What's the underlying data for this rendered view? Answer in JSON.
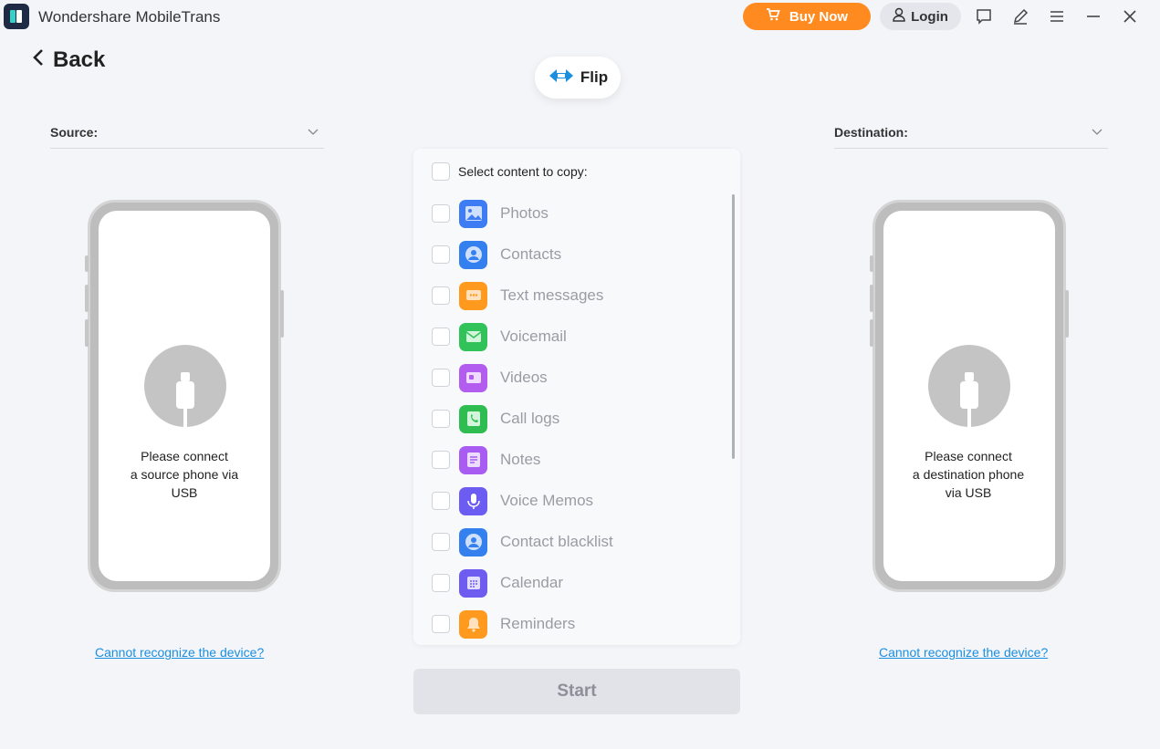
{
  "app": {
    "title": "Wondershare MobileTrans",
    "buy_now_label": "Buy Now",
    "login_label": "Login"
  },
  "nav": {
    "back_label": "Back",
    "flip_label": "Flip"
  },
  "source": {
    "label": "Source:",
    "message_line1": "Please connect",
    "message_line2": "a source phone via",
    "message_line3": "USB",
    "help_link": "Cannot recognize the device?"
  },
  "destination": {
    "label": "Destination:",
    "message_line1": "Please connect",
    "message_line2": "a destination phone",
    "message_line3": "via USB",
    "help_link": "Cannot recognize the device?"
  },
  "content_panel": {
    "header": "Select content to copy:",
    "items": [
      {
        "label": "Photos",
        "icon": "photos-icon",
        "color": "#3d7cf2"
      },
      {
        "label": "Contacts",
        "icon": "contacts-icon",
        "color": "#3580ef"
      },
      {
        "label": "Text messages",
        "icon": "messages-icon",
        "color": "#ff9a1f"
      },
      {
        "label": "Voicemail",
        "icon": "voicemail-icon",
        "color": "#31c25a"
      },
      {
        "label": "Videos",
        "icon": "videos-icon",
        "color": "#b35cf0"
      },
      {
        "label": "Call logs",
        "icon": "call-logs-icon",
        "color": "#2fbd52"
      },
      {
        "label": "Notes",
        "icon": "notes-icon",
        "color": "#a95cf2"
      },
      {
        "label": "Voice Memos",
        "icon": "voice-memos-icon",
        "color": "#6c5cf2"
      },
      {
        "label": "Contact blacklist",
        "icon": "contact-blacklist-icon",
        "color": "#3580ef"
      },
      {
        "label": "Calendar",
        "icon": "calendar-icon",
        "color": "#6e5cf0"
      },
      {
        "label": "Reminders",
        "icon": "reminders-icon",
        "color": "#ff9a1f"
      }
    ]
  },
  "start_label": "Start",
  "colors": {
    "accent_orange": "#ff8a1f",
    "link_blue": "#1a8fe0",
    "flip_blue": "#1a8fe0"
  }
}
